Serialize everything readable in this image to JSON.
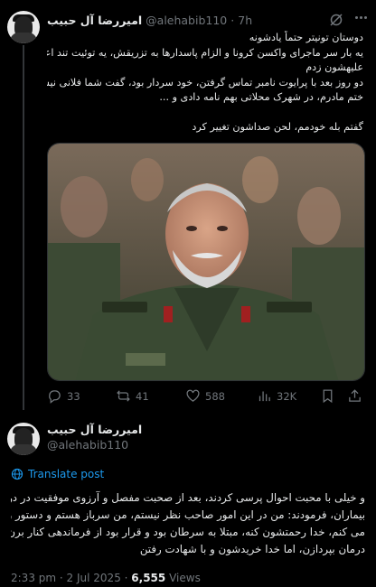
{
  "post1": {
    "display_name": "امیررضا آل حبیب",
    "handle": "@alehabib110",
    "time": "7h",
    "lines": [
      "دوستان تونیتر حتماً یادشونه",
      "یه بار سر ماجرای واکسن کرونا و الزام پاسدارها به تزریقش، یه توئیت تند اعتراضی",
      "علیهشون زدم",
      "دو روز بعد با پرایوت نامبر تماس گرفتن، خود سردار بود، گفت شما فلانی نیستی که تو",
      "ختم مادرم، در شهرک محلاتی بهم نامه دادی و ...",
      "",
      "گفتم بله خودمم، لحن صداشون تغییر کرد"
    ],
    "stats": {
      "replies": "33",
      "reposts": "41",
      "likes": "588",
      "views": "32K"
    }
  },
  "post2": {
    "display_name": "امیررضا آل حبیب",
    "handle": "@alehabib110",
    "translate_label": "Translate post",
    "lines": [
      "و خیلی با محبت احوال پرسی کردند، بعد از صحبت مفصل و آرزوی موفقیت در درمان",
      "بیماران، فرمودند: من در این امور صاحب نظر نیستم، من سرباز هستم و دستور رو اجرا",
      "می کنم، خدا رحمتشون کنه، مبتلا به سرطان بود و قرار بود از فرماندهی کنار برن و به",
      "درمان بپردازن، اما خدا خریدشون و با شهادت رفتن"
    ],
    "time": "2:33 pm",
    "date": "2 Jul 2025",
    "views": "6,555",
    "views_label": "Views"
  },
  "icons": {
    "reply": "comment-icon",
    "repost": "repost-icon",
    "like": "heart-icon",
    "views": "bar-chart-icon",
    "bookmark": "bookmark-icon",
    "share": "share-icon",
    "grok": "grok-icon",
    "more": "more-icon",
    "translate": "globe-icon"
  },
  "colors": {
    "background": "#000000",
    "text": "#e7e9ea",
    "muted": "#71767b",
    "link": "#1d9bf0",
    "uniform": "#3a4a33"
  }
}
